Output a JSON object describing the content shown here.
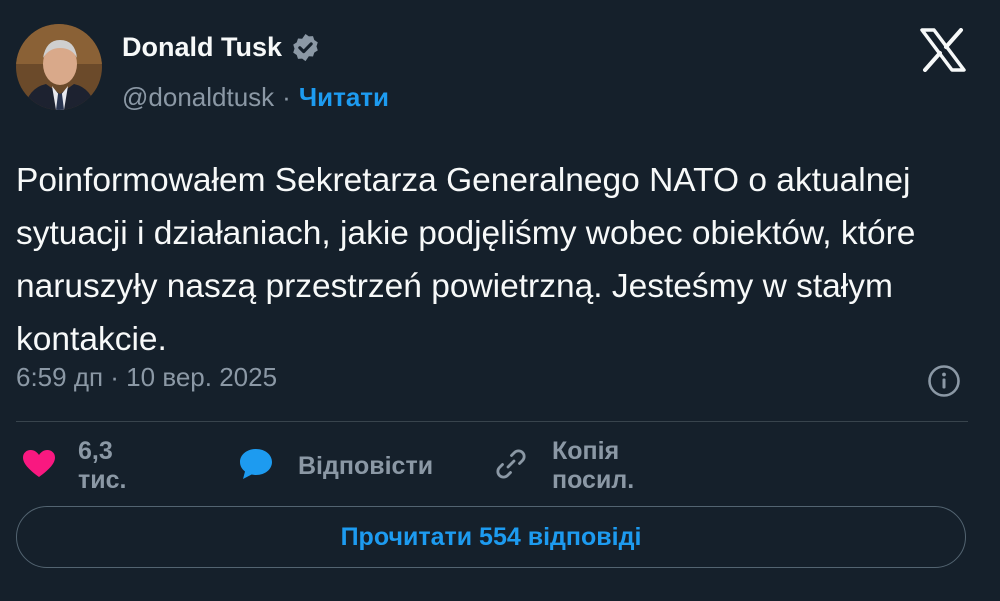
{
  "author": {
    "name": "Donald Tusk",
    "handle": "@donaldtusk",
    "separator": "·",
    "follow_label": "Читати"
  },
  "tweet": {
    "text": "Poinformowałem Sekretarza Generalnego NATO o aktualnej sytuacji i działaniach, jakie podjęliśmy wobec obiektów, które naruszyły naszą przestrzeń powietrzną. Jesteśmy w stałym kontakcie.",
    "timestamp": "6:59 дп · 10 вер. 2025"
  },
  "actions": {
    "like_count": "6,3 тис.",
    "reply_label": "Відповісти",
    "copy_link_label": "Копія посил."
  },
  "read_replies_label": "Прочитати 554 відповіді",
  "colors": {
    "background": "#15202b",
    "accent": "#1d9bf0",
    "like": "#f91880",
    "muted": "#8b98a5"
  }
}
